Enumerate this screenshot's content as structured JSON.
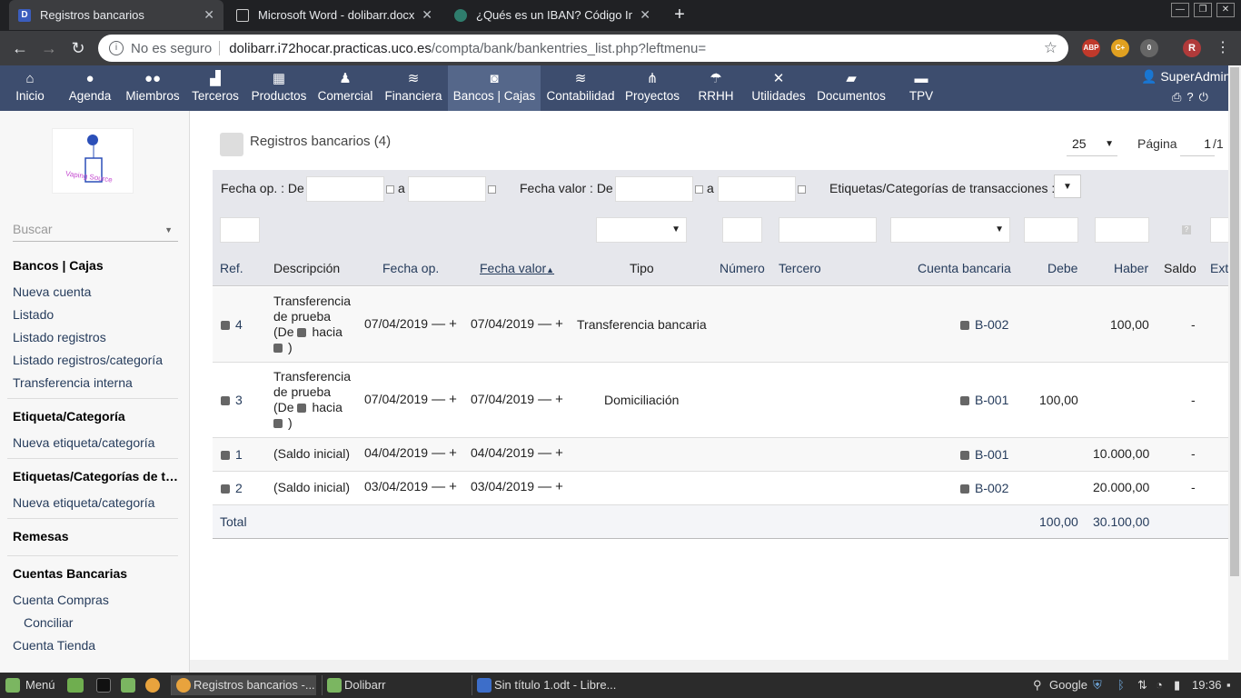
{
  "browser": {
    "tabs": [
      {
        "title": "Registros bancarios",
        "favicon": "D"
      },
      {
        "title": "Microsoft Word - dolibarr.docx",
        "favicon": "doc"
      },
      {
        "title": "¿Qués es un IBAN? Código Inter",
        "favicon": "chart"
      }
    ],
    "security_label": "No es seguro",
    "url_host": "dolibarr.i72hocar.practicas.uco.es",
    "url_path": "/compta/bank/bankentries_list.php?leftmenu=",
    "extensions": [
      "ABP",
      "C+",
      "0",
      "R"
    ]
  },
  "topmenu": {
    "items": [
      {
        "label": "Inicio",
        "icon": "home-icon"
      },
      {
        "label": "Agenda",
        "icon": "agenda-icon"
      },
      {
        "label": "Miembros",
        "icon": "members-icon"
      },
      {
        "label": "Terceros",
        "icon": "companies-icon"
      },
      {
        "label": "Productos",
        "icon": "products-icon"
      },
      {
        "label": "Comercial",
        "icon": "commercial-icon"
      },
      {
        "label": "Financiera",
        "icon": "finance-icon"
      },
      {
        "label": "Bancos | Cajas",
        "icon": "bank-icon"
      },
      {
        "label": "Contabilidad",
        "icon": "accounting-icon"
      },
      {
        "label": "Proyectos",
        "icon": "projects-icon"
      },
      {
        "label": "RRHH",
        "icon": "hrm-icon"
      },
      {
        "label": "Utilidades",
        "icon": "tools-icon"
      },
      {
        "label": "Documentos",
        "icon": "documents-icon"
      },
      {
        "label": "TPV",
        "icon": "pos-icon"
      }
    ],
    "user": "SuperAdmin"
  },
  "sidebar": {
    "logo_text": "Vaping Source",
    "search_placeholder": "Buscar",
    "items": [
      {
        "label": "Bancos | Cajas",
        "type": "header"
      },
      {
        "label": "Nueva cuenta"
      },
      {
        "label": "Listado"
      },
      {
        "label": "Listado registros"
      },
      {
        "label": "Listado registros/categoría"
      },
      {
        "label": "Transferencia interna"
      },
      {
        "label": "Etiqueta/Categoría",
        "type": "header"
      },
      {
        "label": "Nueva etiqueta/categoría"
      },
      {
        "label": "Etiquetas/Categorías de t…",
        "type": "header"
      },
      {
        "label": "Nueva etiqueta/categoría"
      },
      {
        "label": "Remesas",
        "type": "header"
      },
      {
        "label": "Cuentas Bancarias",
        "type": "header"
      },
      {
        "label": "Cuenta Compras"
      },
      {
        "label": "Conciliar"
      },
      {
        "label": "Cuenta Tienda"
      }
    ]
  },
  "page": {
    "title": "Registros bancarios (4)",
    "per_page": "25",
    "page_label": "Página",
    "page_value": "1",
    "page_total": "/1"
  },
  "filters": {
    "fecha_op_label": "Fecha op. : De",
    "a_label": "a",
    "fecha_valor_label": "Fecha valor : De",
    "etiquetas_label": "Etiquetas/Categorías de transacciones :"
  },
  "table": {
    "headers": [
      "Ref.",
      "Descripción",
      "Fecha op.",
      "Fecha valor",
      "Tipo",
      "Número",
      "Tercero",
      "Cuenta bancaria",
      "Debe",
      "Haber",
      "Saldo",
      "Ext"
    ],
    "rows": [
      {
        "ref": "4",
        "desc_l1": "Transferencia",
        "desc_l2": "de prueba",
        "desc_l3": "(De",
        "desc_l4": "hacia",
        "desc_l5": ")",
        "fecha_op": "07/04/2019",
        "fecha_valor": "07/04/2019",
        "tipo": "Transferencia bancaria",
        "cuenta": "B-002",
        "debe": "",
        "haber": "100,00",
        "saldo": "-"
      },
      {
        "ref": "3",
        "desc_l1": "Transferencia",
        "desc_l2": "de prueba",
        "desc_l3": "(De",
        "desc_l4": "hacia",
        "desc_l5": ")",
        "fecha_op": "07/04/2019",
        "fecha_valor": "07/04/2019",
        "tipo": "Domiciliación",
        "cuenta": "B-001",
        "debe": "100,00",
        "haber": "",
        "saldo": "-"
      },
      {
        "ref": "1",
        "desc": "(Saldo inicial)",
        "fecha_op": "04/04/2019",
        "fecha_valor": "04/04/2019",
        "tipo": "",
        "cuenta": "B-001",
        "debe": "",
        "haber": "10.000,00",
        "saldo": "-"
      },
      {
        "ref": "2",
        "desc": "(Saldo inicial)",
        "fecha_op": "03/04/2019",
        "fecha_valor": "03/04/2019",
        "tipo": "",
        "cuenta": "B-002",
        "debe": "",
        "haber": "20.000,00",
        "saldo": "-"
      }
    ],
    "total_label": "Total",
    "total_debe": "100,00",
    "total_haber": "30.100,00"
  },
  "taskbar": {
    "menu_label": "Menú",
    "windows": [
      "Registros bancarios -...",
      "Dolibarr",
      "Sin título 1.odt - Libre..."
    ],
    "search": "Google",
    "time": "19:36"
  }
}
